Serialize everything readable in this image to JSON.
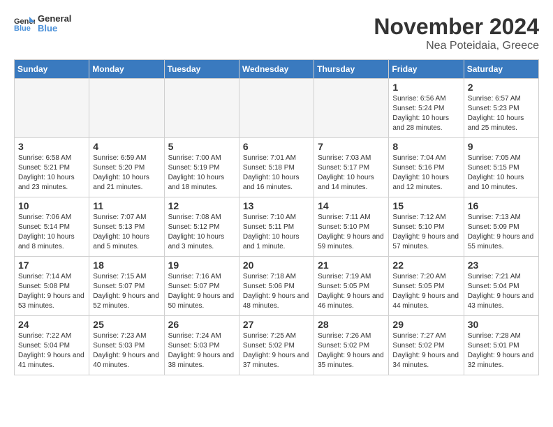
{
  "logo": {
    "general": "General",
    "blue": "Blue"
  },
  "header": {
    "month": "November 2024",
    "location": "Nea Poteidaia, Greece"
  },
  "days_of_week": [
    "Sunday",
    "Monday",
    "Tuesday",
    "Wednesday",
    "Thursday",
    "Friday",
    "Saturday"
  ],
  "weeks": [
    [
      {
        "day": "",
        "info": ""
      },
      {
        "day": "",
        "info": ""
      },
      {
        "day": "",
        "info": ""
      },
      {
        "day": "",
        "info": ""
      },
      {
        "day": "",
        "info": ""
      },
      {
        "day": "1",
        "info": "Sunrise: 6:56 AM\nSunset: 5:24 PM\nDaylight: 10 hours and 28 minutes."
      },
      {
        "day": "2",
        "info": "Sunrise: 6:57 AM\nSunset: 5:23 PM\nDaylight: 10 hours and 25 minutes."
      }
    ],
    [
      {
        "day": "3",
        "info": "Sunrise: 6:58 AM\nSunset: 5:21 PM\nDaylight: 10 hours and 23 minutes."
      },
      {
        "day": "4",
        "info": "Sunrise: 6:59 AM\nSunset: 5:20 PM\nDaylight: 10 hours and 21 minutes."
      },
      {
        "day": "5",
        "info": "Sunrise: 7:00 AM\nSunset: 5:19 PM\nDaylight: 10 hours and 18 minutes."
      },
      {
        "day": "6",
        "info": "Sunrise: 7:01 AM\nSunset: 5:18 PM\nDaylight: 10 hours and 16 minutes."
      },
      {
        "day": "7",
        "info": "Sunrise: 7:03 AM\nSunset: 5:17 PM\nDaylight: 10 hours and 14 minutes."
      },
      {
        "day": "8",
        "info": "Sunrise: 7:04 AM\nSunset: 5:16 PM\nDaylight: 10 hours and 12 minutes."
      },
      {
        "day": "9",
        "info": "Sunrise: 7:05 AM\nSunset: 5:15 PM\nDaylight: 10 hours and 10 minutes."
      }
    ],
    [
      {
        "day": "10",
        "info": "Sunrise: 7:06 AM\nSunset: 5:14 PM\nDaylight: 10 hours and 8 minutes."
      },
      {
        "day": "11",
        "info": "Sunrise: 7:07 AM\nSunset: 5:13 PM\nDaylight: 10 hours and 5 minutes."
      },
      {
        "day": "12",
        "info": "Sunrise: 7:08 AM\nSunset: 5:12 PM\nDaylight: 10 hours and 3 minutes."
      },
      {
        "day": "13",
        "info": "Sunrise: 7:10 AM\nSunset: 5:11 PM\nDaylight: 10 hours and 1 minute."
      },
      {
        "day": "14",
        "info": "Sunrise: 7:11 AM\nSunset: 5:10 PM\nDaylight: 9 hours and 59 minutes."
      },
      {
        "day": "15",
        "info": "Sunrise: 7:12 AM\nSunset: 5:10 PM\nDaylight: 9 hours and 57 minutes."
      },
      {
        "day": "16",
        "info": "Sunrise: 7:13 AM\nSunset: 5:09 PM\nDaylight: 9 hours and 55 minutes."
      }
    ],
    [
      {
        "day": "17",
        "info": "Sunrise: 7:14 AM\nSunset: 5:08 PM\nDaylight: 9 hours and 53 minutes."
      },
      {
        "day": "18",
        "info": "Sunrise: 7:15 AM\nSunset: 5:07 PM\nDaylight: 9 hours and 52 minutes."
      },
      {
        "day": "19",
        "info": "Sunrise: 7:16 AM\nSunset: 5:07 PM\nDaylight: 9 hours and 50 minutes."
      },
      {
        "day": "20",
        "info": "Sunrise: 7:18 AM\nSunset: 5:06 PM\nDaylight: 9 hours and 48 minutes."
      },
      {
        "day": "21",
        "info": "Sunrise: 7:19 AM\nSunset: 5:05 PM\nDaylight: 9 hours and 46 minutes."
      },
      {
        "day": "22",
        "info": "Sunrise: 7:20 AM\nSunset: 5:05 PM\nDaylight: 9 hours and 44 minutes."
      },
      {
        "day": "23",
        "info": "Sunrise: 7:21 AM\nSunset: 5:04 PM\nDaylight: 9 hours and 43 minutes."
      }
    ],
    [
      {
        "day": "24",
        "info": "Sunrise: 7:22 AM\nSunset: 5:04 PM\nDaylight: 9 hours and 41 minutes."
      },
      {
        "day": "25",
        "info": "Sunrise: 7:23 AM\nSunset: 5:03 PM\nDaylight: 9 hours and 40 minutes."
      },
      {
        "day": "26",
        "info": "Sunrise: 7:24 AM\nSunset: 5:03 PM\nDaylight: 9 hours and 38 minutes."
      },
      {
        "day": "27",
        "info": "Sunrise: 7:25 AM\nSunset: 5:02 PM\nDaylight: 9 hours and 37 minutes."
      },
      {
        "day": "28",
        "info": "Sunrise: 7:26 AM\nSunset: 5:02 PM\nDaylight: 9 hours and 35 minutes."
      },
      {
        "day": "29",
        "info": "Sunrise: 7:27 AM\nSunset: 5:02 PM\nDaylight: 9 hours and 34 minutes."
      },
      {
        "day": "30",
        "info": "Sunrise: 7:28 AM\nSunset: 5:01 PM\nDaylight: 9 hours and 32 minutes."
      }
    ]
  ]
}
